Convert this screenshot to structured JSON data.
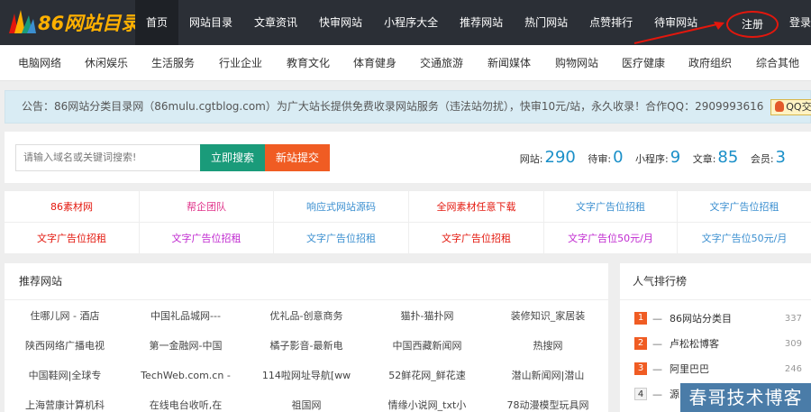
{
  "header": {
    "logo_text": "86网站目录",
    "nav": [
      "首页",
      "网站目录",
      "文章资讯",
      "快审网站",
      "小程序大全",
      "推荐网站",
      "热门网站",
      "点赞排行",
      "待审网站"
    ],
    "register": "注册",
    "login": "登录"
  },
  "categories": [
    "电脑网络",
    "休闲娱乐",
    "生活服务",
    "行业企业",
    "教育文化",
    "体育健身",
    "交通旅游",
    "新闻媒体",
    "购物网站",
    "医疗健康",
    "政府组织",
    "综合其他"
  ],
  "notice": {
    "text": "公告：86网站分类目录网（86mulu.cgtblog.com）为广大站长提供免费收录网站服务（违法站勿扰），快审10元/站，永久收录！合作QQ：2909993616",
    "qq_label": "QQ交谈"
  },
  "search": {
    "placeholder": "请输入域名或关键词搜索!",
    "search_button": "立即搜索",
    "submit_button": "新站提交"
  },
  "stats": {
    "sites_label": "网站:",
    "sites": "290",
    "pending_label": "待审:",
    "pending": "0",
    "miniapps_label": "小程序:",
    "miniapps": "9",
    "articles_label": "文章:",
    "articles": "85",
    "members_label": "会员:",
    "members": "3"
  },
  "ads": [
    {
      "text": "86素材网",
      "color": "#e3170d"
    },
    {
      "text": "帮企团队",
      "color": "#e0338a"
    },
    {
      "text": "响应式网站源码",
      "color": "#3b8fd0"
    },
    {
      "text": "全网素材任意下载",
      "color": "#e3170d"
    },
    {
      "text": "文字广告位招租",
      "color": "#3b8fd0"
    },
    {
      "text": "文字广告位招租",
      "color": "#3b8fd0"
    },
    {
      "text": "文字广告位招租",
      "color": "#e3170d"
    },
    {
      "text": "文字广告位招租",
      "color": "#c02ad0"
    },
    {
      "text": "文字广告位招租",
      "color": "#3b8fd0"
    },
    {
      "text": "文字广告位招租",
      "color": "#e3170d"
    },
    {
      "text": "文字广告位50元/月",
      "color": "#c02ad0"
    },
    {
      "text": "文字广告位50元/月",
      "color": "#3b8fd0"
    }
  ],
  "recommended": {
    "title": "推荐网站",
    "sites": [
      "住哪儿网 - 酒店",
      "中国礼品城网---",
      "优礼品-创意商务",
      "猫扑-猫扑网",
      "装修知识_家居装",
      "陕西网络广播电视",
      "第一金融网-中国",
      "橘子影音-最新电",
      "中国西藏新闻网",
      "热搜网",
      "中国鞋网|全球专",
      "TechWeb.com.cn -",
      "114啦网址导航[ww",
      "52鲜花网_鲜花速",
      "潜山新闻网|潜山",
      "上海营康计算机科",
      "在线电台收听,在",
      "祖国网",
      "情缘小说网_txt小",
      "78动漫模型玩具网"
    ]
  },
  "ranking": {
    "title": "人气排行榜",
    "items": [
      {
        "rank": "1",
        "name": "86网站分类目",
        "count": "337",
        "color": "#f05c23"
      },
      {
        "rank": "2",
        "name": "卢松松博客",
        "count": "309",
        "color": "#f05c23"
      },
      {
        "rank": "3",
        "name": "阿里巴巴",
        "count": "246",
        "color": "#f05c23"
      },
      {
        "rank": "4",
        "name": "源",
        "count": "",
        "color": "#ffffff"
      }
    ]
  },
  "watermark": "春哥技术博客",
  "colors": {
    "topbar": "#2b2f36",
    "accent_green": "#1a9b7a",
    "accent_orange": "#f05c23",
    "stat_blue": "#1a8fc8",
    "notice_bg": "#d9ecf4"
  }
}
